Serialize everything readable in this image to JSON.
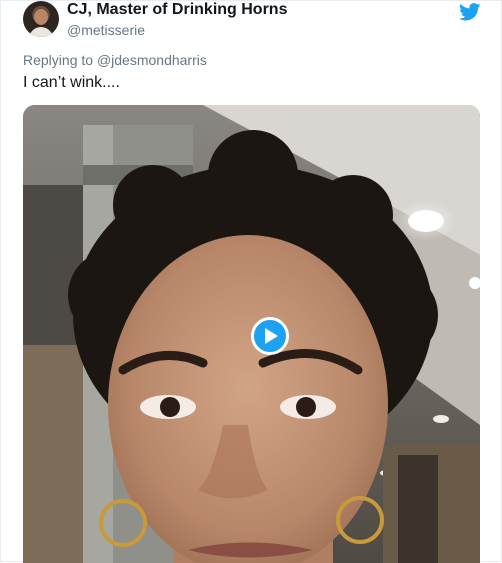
{
  "tweet": {
    "display_name": "CJ, Master of Drinking Horns",
    "handle": "@metisserie",
    "reply_prefix": "Replying to",
    "reply_mention": "@jdesmondharris",
    "text": "I can’t wink....",
    "media_type": "video",
    "brand_icon": "twitter-bird-icon",
    "brand_color": "#1da1f2",
    "play_icon": "play-icon"
  }
}
